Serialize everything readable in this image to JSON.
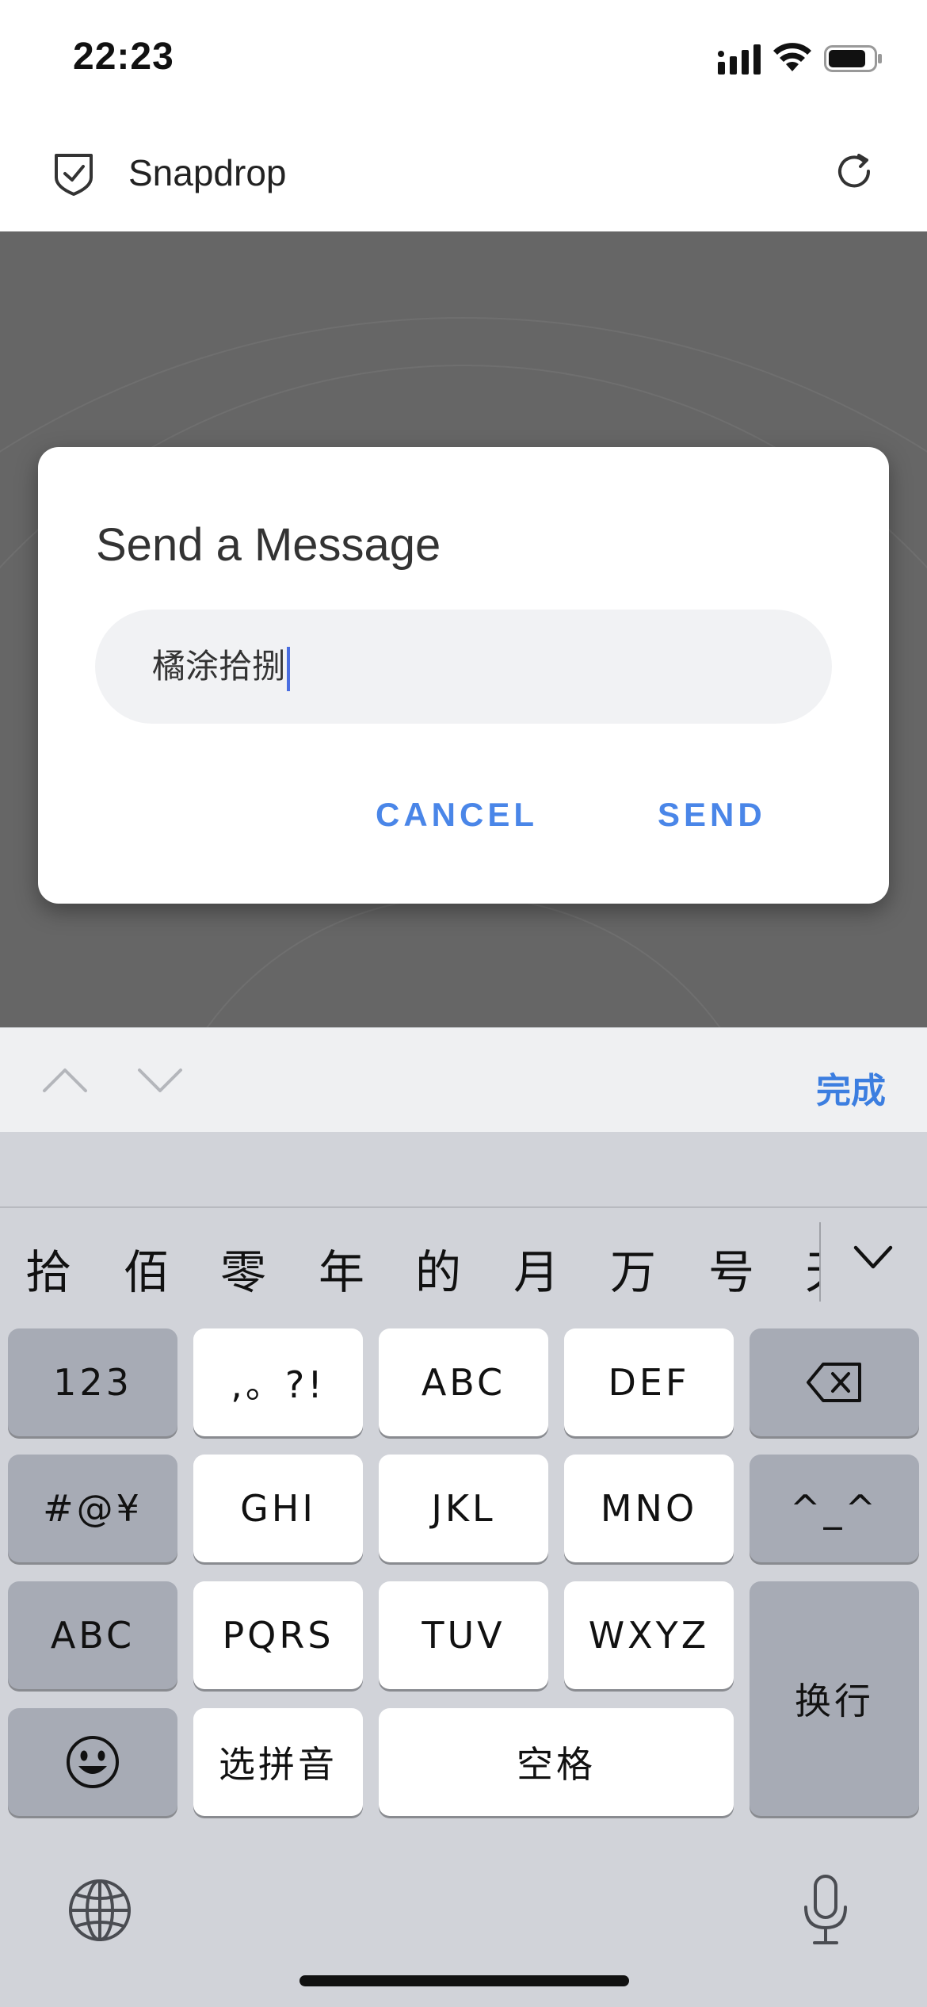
{
  "status_bar": {
    "time": "22:23"
  },
  "header": {
    "title": "Snapdrop"
  },
  "dialog": {
    "title": "Send a Message",
    "input_value": "橘涂拾捌",
    "cancel_label": "CANCEL",
    "send_label": "SEND"
  },
  "toolbar": {
    "done_label": "完成"
  },
  "candidates": [
    "拾",
    "佰",
    "零",
    "年",
    "的",
    "月",
    "万",
    "号",
    "天"
  ],
  "keys": {
    "k123": "123",
    "punct": ",。?!",
    "abc_keys": "ABC",
    "def": "DEF",
    "symbols": "#@¥",
    "ghi": "GHI",
    "jkl": "JKL",
    "mno": "MNO",
    "kaomoji": "^_^",
    "abc": "ABC",
    "pqrs": "PQRS",
    "tuv": "TUV",
    "wxyz": "WXYZ",
    "newline": "换行",
    "pinyin": "选拼音",
    "space": "空格"
  },
  "icons": {
    "logo": "shield-check-icon",
    "refresh": "refresh-icon",
    "prev": "chevron-up-icon",
    "next": "chevron-down-icon",
    "expand": "chevron-down-icon",
    "backspace": "backspace-icon",
    "emoji": "emoji-icon",
    "globe": "globe-icon",
    "mic": "microphone-icon"
  },
  "colors": {
    "accent": "#4a86e8",
    "backdrop": "#666666",
    "keyboard": "#d1d3d9"
  }
}
